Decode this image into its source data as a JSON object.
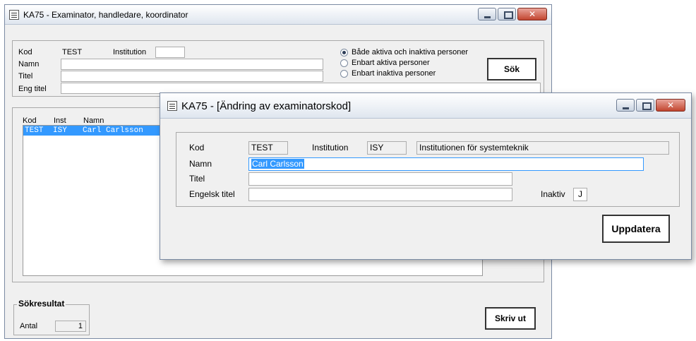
{
  "main_window": {
    "title": "KA75 - Examinator, handledare, koordinator",
    "search": {
      "kod_label": "Kod",
      "kod_value": "TEST",
      "institution_label": "Institution",
      "institution_value": "",
      "namn_label": "Namn",
      "namn_value": "",
      "titel_label": "Titel",
      "titel_value": "",
      "eng_titel_label": "Eng titel",
      "eng_titel_value": "",
      "radio_options": [
        {
          "label": "Både aktiva och inaktiva personer",
          "selected": true
        },
        {
          "label": "Enbart aktiva personer",
          "selected": false
        },
        {
          "label": "Enbart inaktiva personer",
          "selected": false
        }
      ],
      "search_button": "Sök"
    },
    "results": {
      "columns": [
        "Kod",
        "Inst",
        "Namn"
      ],
      "rows": [
        {
          "kod": "TEST",
          "inst": "ISY",
          "namn": "Carl Carlsson",
          "selected": true
        }
      ]
    },
    "summary": {
      "group_title": "Sökresultat",
      "antal_label": "Antal",
      "antal_value": "1",
      "print_button": "Skriv ut"
    }
  },
  "dialog": {
    "title": "KA75 - [Ändring av examinatorskod]",
    "kod_label": "Kod",
    "kod_value": "TEST",
    "institution_label": "Institution",
    "institution_code": "ISY",
    "institution_name": "Institutionen för systemteknik",
    "namn_label": "Namn",
    "namn_value": "Carl Carlsson",
    "titel_label": "Titel",
    "titel_value": "",
    "engelsk_titel_label": "Engelsk titel",
    "engelsk_titel_value": "",
    "inaktiv_label": "Inaktiv",
    "inaktiv_value": "J",
    "update_button": "Uppdatera"
  },
  "colors": {
    "selection": "#3399ff",
    "selection_text": "#ffffff",
    "close_button": "#c2452f"
  }
}
